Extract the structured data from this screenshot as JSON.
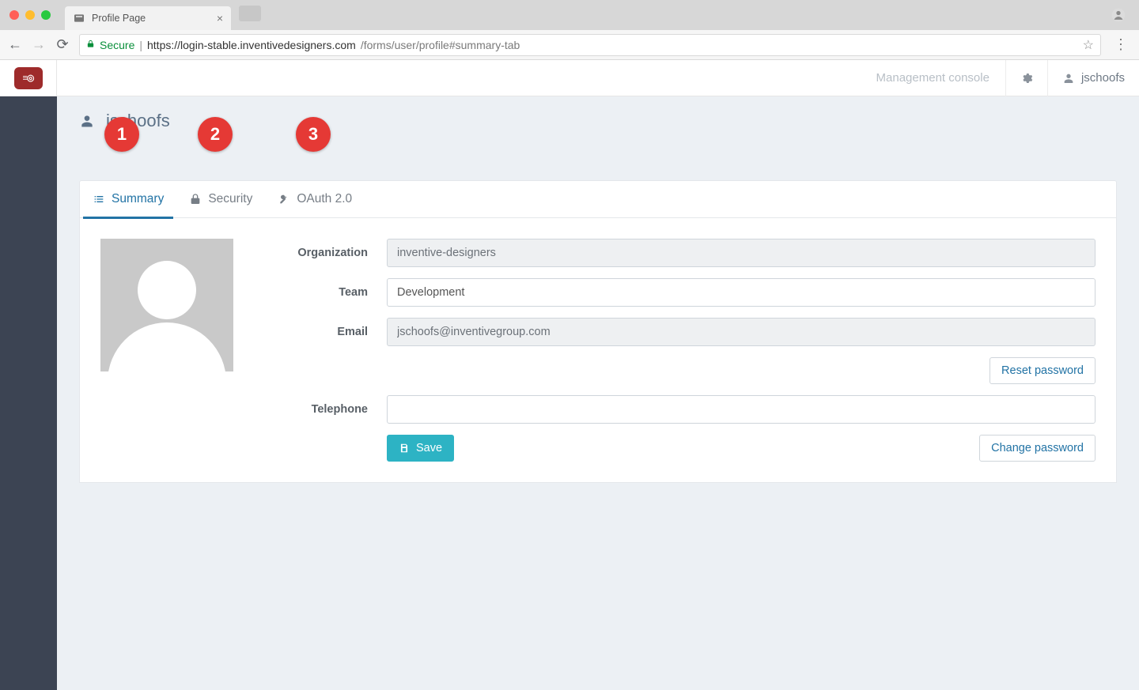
{
  "browser": {
    "tab_title": "Profile Page",
    "secure_label": "Secure",
    "url_host": "https://login-stable.inventivedesigners.com",
    "url_path": "/forms/user/profile#summary-tab"
  },
  "header": {
    "management_console": "Management console",
    "username": "jschoofs"
  },
  "page": {
    "title": "jschoofs"
  },
  "tabs": {
    "summary": "Summary",
    "security": "Security",
    "oauth": "OAuth 2.0"
  },
  "annotations": {
    "one": "1",
    "two": "2",
    "three": "3"
  },
  "form": {
    "labels": {
      "organization": "Organization",
      "team": "Team",
      "email": "Email",
      "telephone": "Telephone"
    },
    "values": {
      "organization": "inventive-designers",
      "team": "Development",
      "email": "jschoofs@inventivegroup.com",
      "telephone": ""
    },
    "buttons": {
      "reset_password": "Reset password",
      "change_password": "Change password",
      "save": "Save"
    }
  }
}
